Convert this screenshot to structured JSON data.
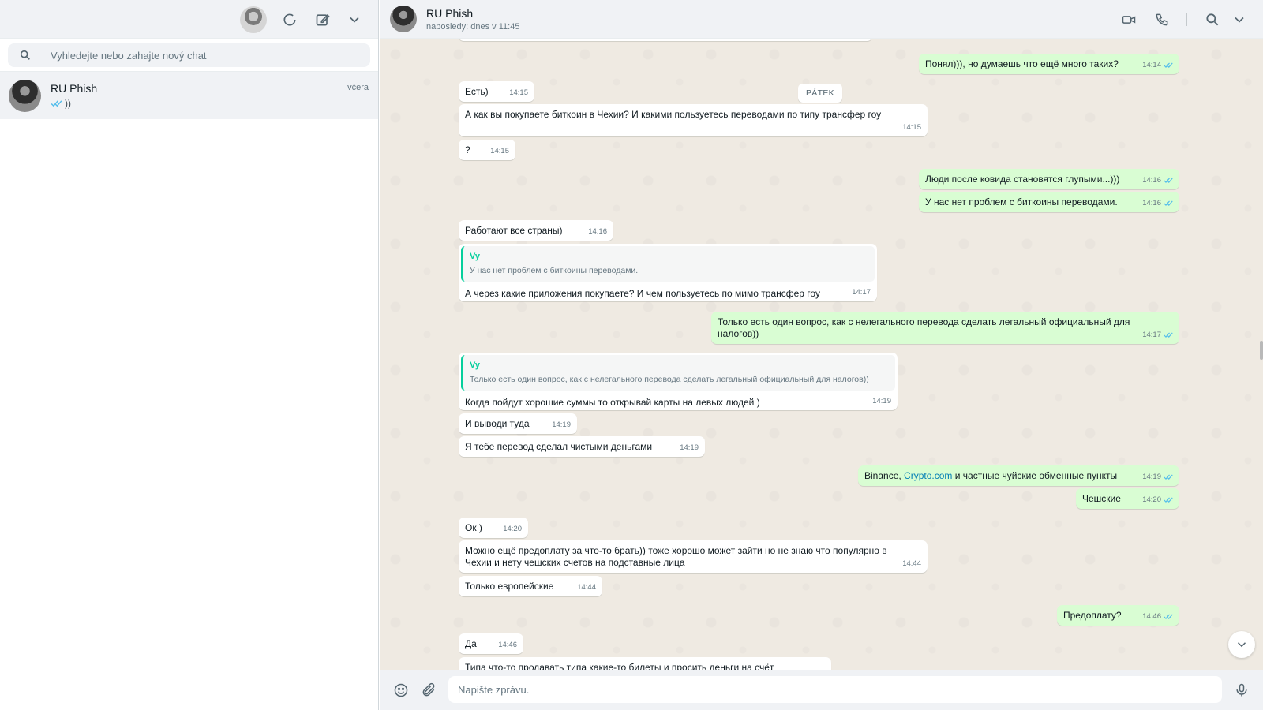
{
  "left": {
    "search_placeholder": "Vyhledejte nebo zahajte nový chat",
    "chats": [
      {
        "name": "RU Phish",
        "time": "včera",
        "preview": "))"
      }
    ]
  },
  "conversation": {
    "title": "RU Phish",
    "subtitle": "naposledy: dnes v 11:45",
    "date_chip": "PÁTEK",
    "composer_placeholder": "Napište zprávu.",
    "messages": {
      "m1": {
        "text": "Понял))), но думаешь что ещё много таких?",
        "time": "14:14"
      },
      "m2": {
        "text": "Есть)",
        "time": "14:15"
      },
      "m3": {
        "text": "А как вы покупаете биткоин в Чехии? И какими пользуетесь переводами по типу трансфер гоу",
        "time": "14:15"
      },
      "m4": {
        "text": "?",
        "time": "14:15"
      },
      "m5": {
        "text": "Люди после ковида становятся глупыми...)))",
        "time": "14:16"
      },
      "m6": {
        "text": "У нас нет проблем с биткоины переводами.",
        "time": "14:16"
      },
      "m7": {
        "text": "Работают все страны)",
        "time": "14:16"
      },
      "m8": {
        "quote_name": "Vy",
        "quote_text": "У нас нет проблем с биткоины переводами.",
        "text": "А через какие приложения покупаете? И чем пользуетесь по мимо трансфер гоу",
        "time": "14:17"
      },
      "m9": {
        "text": "Только есть один вопрос, как с нелегального перевода сделать легальный официальный для налогов))",
        "time": "14:17"
      },
      "m10": {
        "quote_name": "Vy",
        "quote_text": "Только есть один вопрос, как с нелегального перевода сделать легальный официальный для налогов))",
        "text": "Когда пойдут хорошие суммы то открывай карты на левых людей )",
        "time": "14:19"
      },
      "m11": {
        "text": "И выводи туда",
        "time": "14:19"
      },
      "m12": {
        "text": "Я тебе перевод сделал чистыми деньгами",
        "time": "14:19"
      },
      "m13": {
        "text_before": "Binance, ",
        "link": "Crypto.com",
        "text_after": " и частные чуйские обменные пункты",
        "time": "14:19"
      },
      "m14": {
        "text": "Чешские",
        "time": "14:20"
      },
      "m15": {
        "text": "Ок )",
        "time": "14:20"
      },
      "m16": {
        "text": "Можно ещё предоплату за что-то брать)) тоже хорошо может зайти но не знаю что популярно в Чехии и нету чешских счетов на подставные лица",
        "time": "14:44"
      },
      "m17": {
        "text": "Только европейские",
        "time": "14:44"
      },
      "m18": {
        "text": "Предоплату?",
        "time": "14:46"
      },
      "m19": {
        "text": "Да",
        "time": "14:46"
      },
      "m20": {
        "text": "Типа что-то продавать типа какие-то билеты и просить деньги на счёт",
        "time": ""
      }
    }
  },
  "colors": {
    "incoming": "#ffffff",
    "outgoing": "#d9fdd3",
    "accent": "#06cf9c",
    "read_ticks": "#53bdeb",
    "link": "#027eb5"
  },
  "icons": {
    "status": "status-icon",
    "new_chat": "new-chat-icon",
    "menu": "chevron-down-icon",
    "search": "search-icon",
    "video": "video-call-icon",
    "phone": "phone-icon",
    "emoji": "emoji-icon",
    "attach": "paperclip-icon",
    "mic": "microphone-icon"
  }
}
